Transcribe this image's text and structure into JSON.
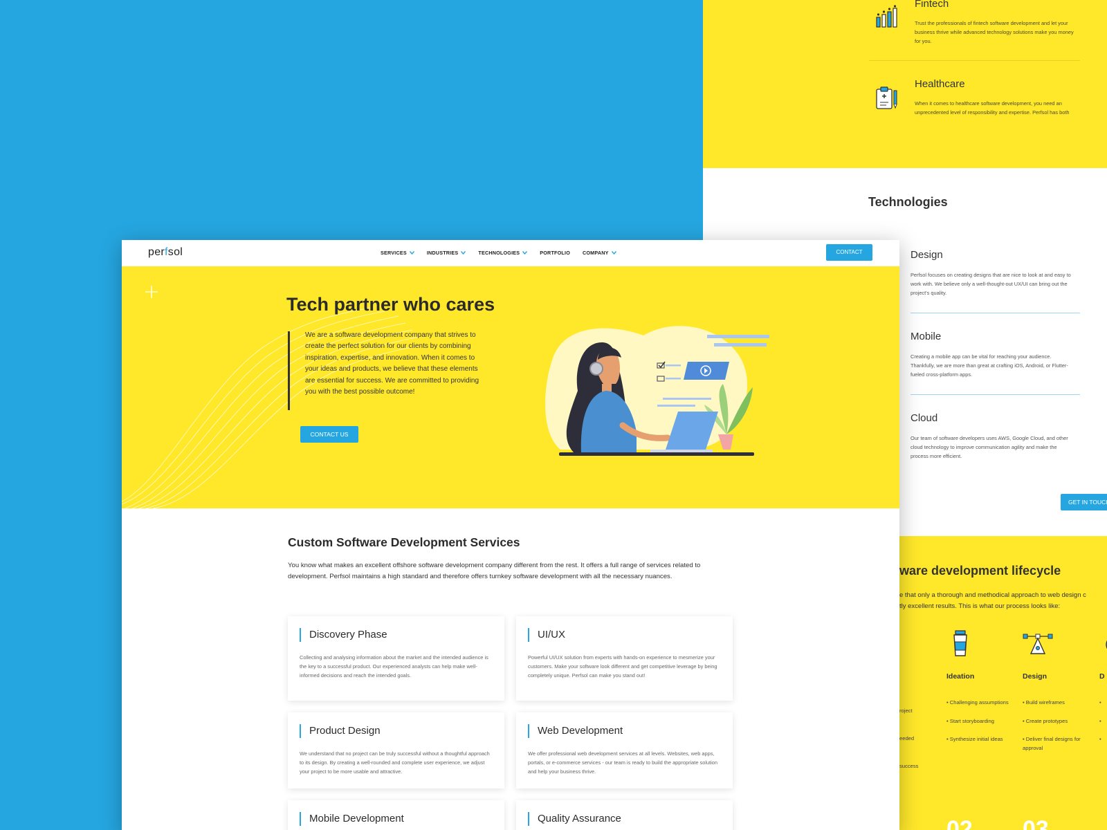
{
  "back_page": {
    "industries": [
      {
        "title": "Fintech",
        "text": "Trust the professionals of fintech software development and let your business thrive while advanced technology solutions make you money for you.",
        "icon": "chart-bars-icon"
      },
      {
        "title": "Healthcare",
        "text": "When it comes to healthcare software development, you need an unprecedented level of responsibility and expertise. Perfsol has both",
        "icon": "medical-clipboard-icon"
      }
    ],
    "technologies_title": "Technologies",
    "technologies": [
      {
        "title": "Design",
        "text": "Perfsol focuses on creating designs that are nice to look at and easy to work with. We believe only a well-thought-out UX/UI can bring out the project's quality."
      },
      {
        "title": "Mobile",
        "text": "Creating a mobile app can be vital for reaching your audience. Thankfully, we are more than great at crafting iOS, Android, or Flutter-fueled cross-platform apps."
      },
      {
        "title": "Cloud",
        "text": "Our team of software developers uses AWS, Google Cloud, and other cloud technology to improve communication agility and make the process more efficient."
      }
    ],
    "get_in_touch": "GET IN TOUCH",
    "lifecycle": {
      "title": "ware development lifecycle",
      "subtitle_line1": "e that only a thorough and methodical approach to web design c",
      "subtitle_line2": "tly excellent results. This is what our process looks like:",
      "left_fragments": [
        "roject",
        "eeded",
        "success"
      ],
      "steps": [
        {
          "title": "Ideation",
          "icon": "coffee-cup-icon",
          "items": [
            "• Challenging assumptions",
            "• Start storyboarding",
            "• Synthesize initial ideas"
          ],
          "number": "02"
        },
        {
          "title": "Design",
          "icon": "pen-tool-icon",
          "items": [
            "• Build wireframes",
            "• Create prototypes",
            "• Deliver final designs for approval"
          ],
          "number": "03"
        },
        {
          "title": "D",
          "icon": "gear-icon",
          "items": [
            "•",
            "•",
            "•"
          ]
        }
      ]
    }
  },
  "front_page": {
    "logo": {
      "before": "per",
      "f": "f",
      "after": "sol"
    },
    "menu": [
      {
        "label": "SERVICES",
        "dropdown": true
      },
      {
        "label": "INDUSTRIES",
        "dropdown": true
      },
      {
        "label": "TECHNOLOGIES",
        "dropdown": true
      },
      {
        "label": "PORTFOLIO",
        "dropdown": false
      },
      {
        "label": "COMPANY",
        "dropdown": true
      }
    ],
    "contact_button": "CONTACT",
    "hero": {
      "title": "Tech partner who cares",
      "text": "We are a software development company that strives to create the perfect solution for our clients by combining inspiration, expertise, and innovation. When it comes to your ideas and products, we believe that these elements are essential for success. We are committed to providing you with the best possible outcome!",
      "cta": "CONTACT US"
    },
    "services": {
      "title": "Custom Software Development Services",
      "intro": "You know what makes an excellent offshore software development company different from the rest. It offers a full range of services related to development. Perfsol maintains a high standard and therefore offers turnkey software development with all the necessary nuances.",
      "cards": [
        {
          "title": "Discovery Phase",
          "text": "Collecting and analysing information about the market and the intended audience is the key to a successful product. Our experienced analysts can help make well-informed decisions and reach the intended goals."
        },
        {
          "title": "UI/UX",
          "text": "Powerful UI/UX solution from experts with hands-on experience to mesmerize your customers. Make your software look different and get competitive leverage by being completely unique. Perfsol can make you stand out!"
        },
        {
          "title": "Product Design",
          "text": "We understand that no project can be truly successful without a thoughtful approach to its design. By creating a well-rounded and complete user experience, we adjust your project to be more usable and attractive."
        },
        {
          "title": "Web Development",
          "text": "We offer professional web development services at all levels. Websites, web apps, portals, or e-commerce services - our team is ready to build the appropriate solution and help your business thrive."
        },
        {
          "title": "Mobile Development",
          "text": ""
        },
        {
          "title": "Quality Assurance",
          "text": ""
        }
      ]
    }
  },
  "colors": {
    "background": "#25a6e0",
    "yellow": "#ffe82a",
    "accent": "#25a6e0",
    "text": "#2b2b2b"
  }
}
